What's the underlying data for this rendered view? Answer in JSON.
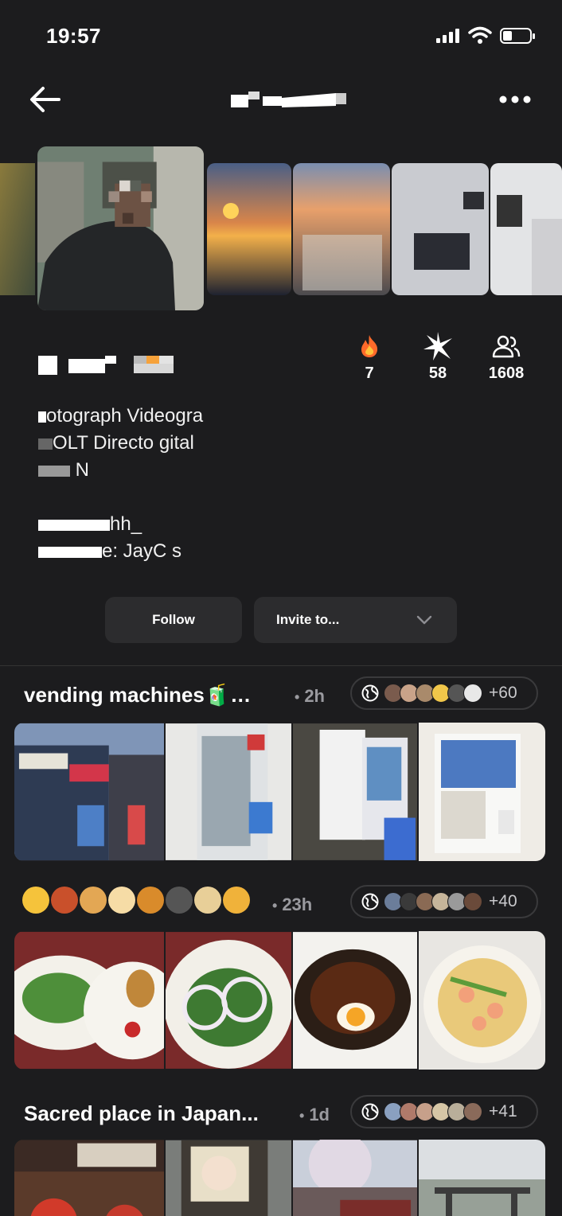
{
  "status_bar": {
    "time": "19:57"
  },
  "profile": {
    "stats": [
      {
        "icon": "fire-icon",
        "value": "7"
      },
      {
        "icon": "sparkle-icon",
        "value": "58"
      },
      {
        "icon": "people-icon",
        "value": "1608"
      }
    ],
    "bio": {
      "line1": "otograph      Videogra",
      "line2": "OLT        Directo    gital",
      "line3": "  N",
      "line4": "hh_",
      "line5": "e: JayC          s"
    }
  },
  "actions": {
    "follow_label": "Follow",
    "invite_label": "Invite to..."
  },
  "albums": [
    {
      "title": "vending machines🧃…",
      "time": "2h",
      "members_extra": "+60",
      "photo_count": 4
    },
    {
      "title": "",
      "time": "23h",
      "members_extra": "+40",
      "photo_count": 4
    },
    {
      "title": "Sacred place in Japan...",
      "time": "1d",
      "members_extra": "+41",
      "photo_count": 4
    }
  ],
  "colors": {
    "background": "#1c1c1e",
    "button": "#2c2c2e",
    "muted_text": "#9a9a9f",
    "accent_fire": "#ff6a2a"
  }
}
